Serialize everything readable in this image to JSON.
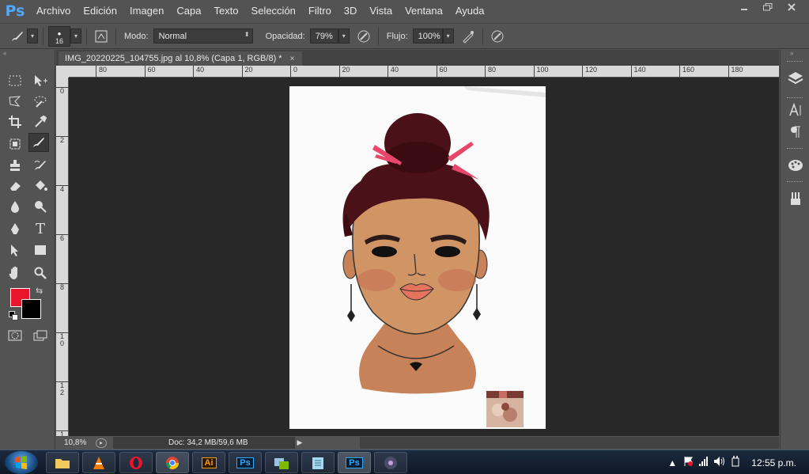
{
  "app": {
    "logo": "Ps",
    "menu": [
      "Archivo",
      "Edición",
      "Imagen",
      "Capa",
      "Texto",
      "Selección",
      "Filtro",
      "3D",
      "Vista",
      "Ventana",
      "Ayuda"
    ]
  },
  "options": {
    "brush_size": "16",
    "mode_label": "Modo:",
    "mode_value": "Normal",
    "opacity_label": "Opacidad:",
    "opacity_value": "79%",
    "flow_label": "Flujo:",
    "flow_value": "100%"
  },
  "document": {
    "tab_title": "IMG_20220225_104755.jpg al 10,8% (Capa 1, RGB/8) *",
    "close_glyph": "×"
  },
  "ruler": {
    "top_ticks": [
      "80",
      "60",
      "40",
      "20",
      "0",
      "20",
      "40",
      "60",
      "80",
      "100",
      "120",
      "140",
      "160",
      "180"
    ],
    "left_ticks": [
      "0",
      "2",
      "4",
      "6",
      "8",
      "1\n0",
      "1\n2",
      "1\n4"
    ]
  },
  "status": {
    "zoom": "10,8%",
    "doc_info": "Doc: 34,2 MB/59,6 MB"
  },
  "colors": {
    "foreground": "#e8152d",
    "background": "#000000"
  },
  "taskbar": {
    "apps": [
      "explorer-icon",
      "vlc-icon",
      "opera-icon",
      "chrome-icon",
      "illustrator-icon",
      "photoshop-icon",
      "photos-icon",
      "notes-icon",
      "photoshop-active-icon",
      "media-icon"
    ],
    "ai_label": "Ai",
    "ps_label": "Ps",
    "clock": "12:55 p.m."
  }
}
